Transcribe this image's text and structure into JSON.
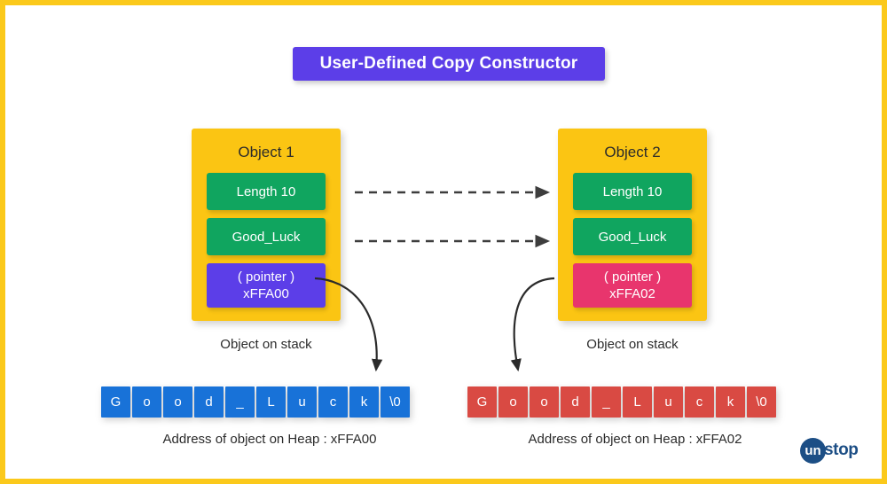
{
  "page": {
    "border_color": "#fbc91b",
    "background": "#ffffff"
  },
  "title": {
    "text": "User-Defined Copy Constructor",
    "background": "#5c3ee8",
    "text_color": "#ffffff"
  },
  "objects": [
    {
      "title": "Object 1",
      "card_color": "#fbc513",
      "fields": [
        {
          "name": "length",
          "label": "Length 10",
          "color": "#10a55f"
        },
        {
          "name": "string",
          "label": "Good_Luck",
          "color": "#10a55f"
        },
        {
          "name": "pointer",
          "label": "( pointer )",
          "value": "xFFA00",
          "color": "#5c3ee8"
        }
      ],
      "stack_caption": "Object on stack"
    },
    {
      "title": "Object 2",
      "card_color": "#fbc513",
      "fields": [
        {
          "name": "length",
          "label": "Length 10",
          "color": "#10a55f"
        },
        {
          "name": "string",
          "label": "Good_Luck",
          "color": "#10a55f"
        },
        {
          "name": "pointer",
          "label": "( pointer )",
          "value": "xFFA02",
          "color": "#e8356d"
        }
      ],
      "stack_caption": "Object on stack"
    }
  ],
  "heap_arrays": [
    {
      "name": "left-heap-array",
      "cell_color": "#1872d8",
      "cells": [
        "G",
        "o",
        "o",
        "d",
        "_",
        "L",
        "u",
        "c",
        "k",
        "\\0"
      ],
      "caption": "Address of object on Heap : xFFA00"
    },
    {
      "name": "right-heap-array",
      "cell_color": "#d94a43",
      "cells": [
        "G",
        "o",
        "o",
        "d",
        "_",
        "L",
        "u",
        "c",
        "k",
        "\\0"
      ],
      "caption": "Address of object on Heap : xFFA02"
    }
  ],
  "arrows": {
    "dashed_count": 2,
    "dashed_color": "#3d3d3d",
    "curved_color": "#2b2b2b"
  },
  "logo": {
    "mark": "un",
    "word": "stop",
    "color": "#1c4e85"
  }
}
